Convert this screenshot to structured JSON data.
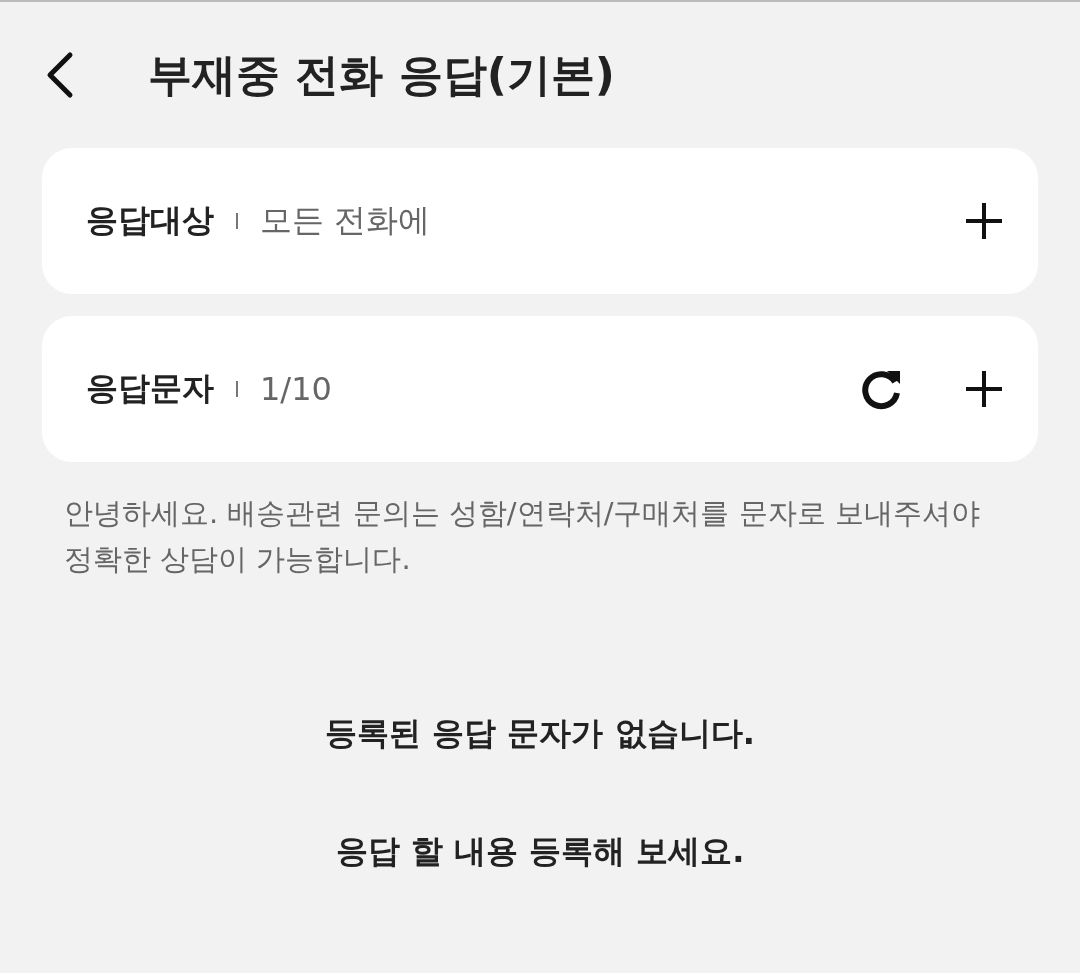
{
  "header": {
    "title": "부재중 전화 응답(기본)"
  },
  "sections": [
    {
      "label": "응답대상",
      "value": "모든 전화에",
      "actions": [
        {
          "kind": "add"
        }
      ]
    },
    {
      "label": "응답문자",
      "value": "1/10",
      "actions": [
        {
          "kind": "refresh"
        },
        {
          "kind": "add"
        }
      ]
    }
  ],
  "message": "안녕하세요. 배송관련 문의는 성함/연락처/구매처를 문자로 보내주셔야 정확한 상담이 가능합니다.",
  "empty_state": [
    "등록된 응답 문자가 없습니다.",
    "응답 할 내용 등록해 보세요."
  ]
}
